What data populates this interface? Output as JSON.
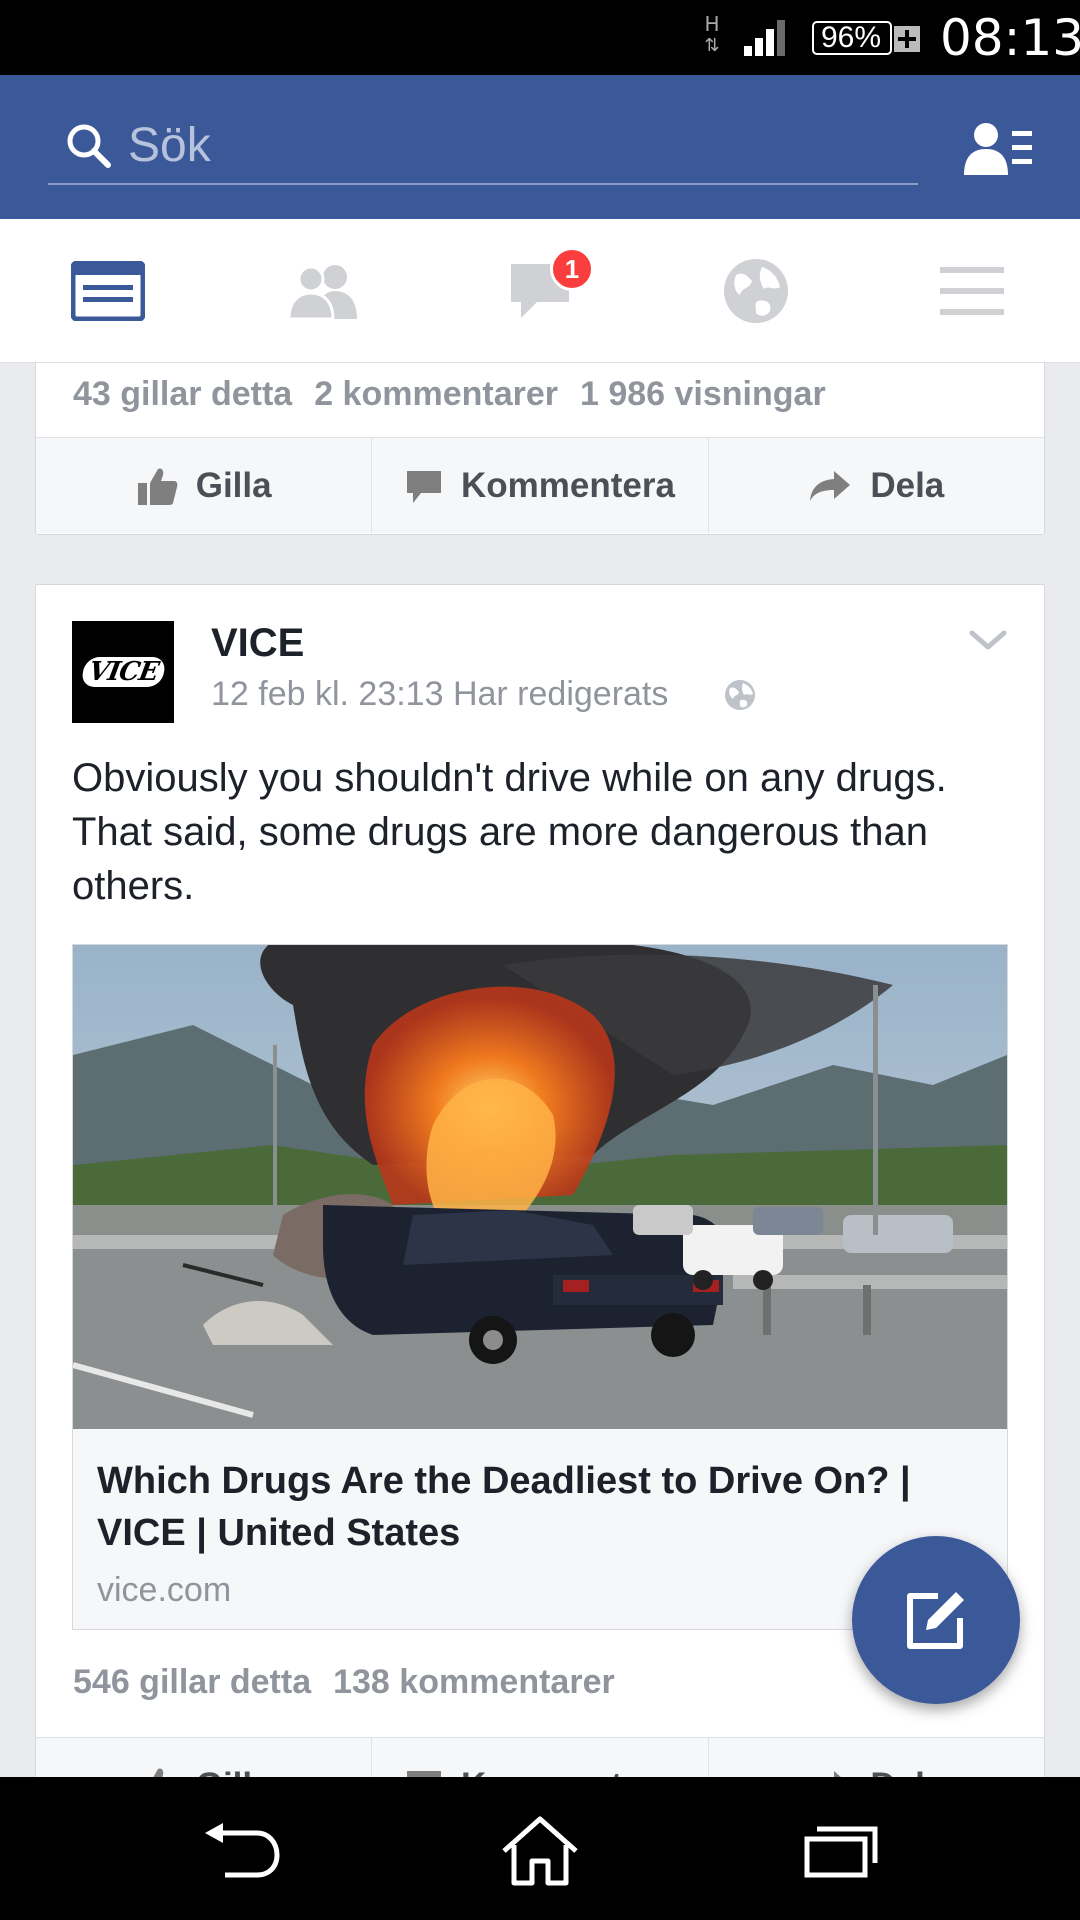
{
  "status_bar": {
    "network": "H",
    "battery": "96%",
    "time": "08:13"
  },
  "search": {
    "placeholder": "Sök"
  },
  "tabs": [
    {
      "name": "news-feed",
      "icon": "news-feed-icon",
      "active": true
    },
    {
      "name": "friends",
      "icon": "friends-icon",
      "active": false
    },
    {
      "name": "messages",
      "icon": "chat-bubble-icon",
      "active": false,
      "badge": "1"
    },
    {
      "name": "notifications",
      "icon": "globe-icon",
      "active": false
    },
    {
      "name": "more",
      "icon": "menu-icon",
      "active": false
    }
  ],
  "colors": {
    "brand_blue": "#3b5998",
    "badge_red": "#fa3e3e",
    "secondary_text": "#90949c"
  },
  "post1": {
    "likes": "43 gillar detta",
    "comments": "2 kommentarer",
    "views": "1 986 visningar",
    "actions": {
      "like": "Gilla",
      "comment": "Kommentera",
      "share": "Dela"
    }
  },
  "post2": {
    "page_name": "VICE",
    "logo_text": "VICE",
    "meta": "12 feb kl. 23:13 Har redigerats",
    "text": "Obviously you shouldn't drive while on any drugs. That said, some drugs are more dangerous than others.",
    "link": {
      "title": "Which Drugs Are the Deadliest to Drive On? | VICE | United States",
      "domain": "vice.com"
    },
    "likes": "546 gillar detta",
    "comments": "138 kommentarer"
  }
}
